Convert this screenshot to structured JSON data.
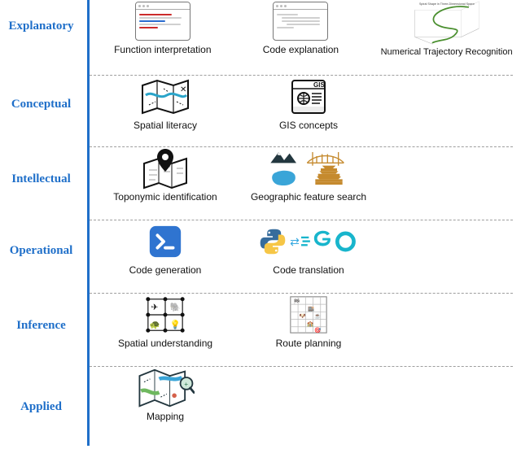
{
  "categories": [
    {
      "label": "Explanatory"
    },
    {
      "label": "Conceptual"
    },
    {
      "label": "Intellectual"
    },
    {
      "label": "Operational"
    },
    {
      "label": "Inference"
    },
    {
      "label": "Applied"
    }
  ],
  "rows": [
    {
      "items": [
        {
          "label": "Function interpretation",
          "icon": "code-window-qa"
        },
        {
          "label": "Code explanation",
          "icon": "code-window-code"
        },
        {
          "label": "Numerical Trajectory Recognition",
          "icon": "trajectory-3d",
          "title": "Spiral Shape in Three-Dimensional Space"
        }
      ]
    },
    {
      "items": [
        {
          "label": "Spatial literacy",
          "icon": "map-icon"
        },
        {
          "label": "GIS concepts",
          "icon": "gis-book",
          "badge": "GIS"
        }
      ]
    },
    {
      "items": [
        {
          "label": "Toponymic identification",
          "icon": "map-pin"
        },
        {
          "label": "Geographic feature search",
          "icon": "landmark-collage"
        }
      ]
    },
    {
      "items": [
        {
          "label": "Code generation",
          "icon": "terminal-icon"
        },
        {
          "label": "Code translation",
          "icon": "python-to-go",
          "from": "Python",
          "to": "GO"
        }
      ]
    },
    {
      "items": [
        {
          "label": "Spatial understanding",
          "icon": "grid-objects"
        },
        {
          "label": "Route planning",
          "icon": "grid-route"
        }
      ]
    },
    {
      "items": [
        {
          "label": "Mapping",
          "icon": "map-magnify"
        }
      ]
    }
  ]
}
